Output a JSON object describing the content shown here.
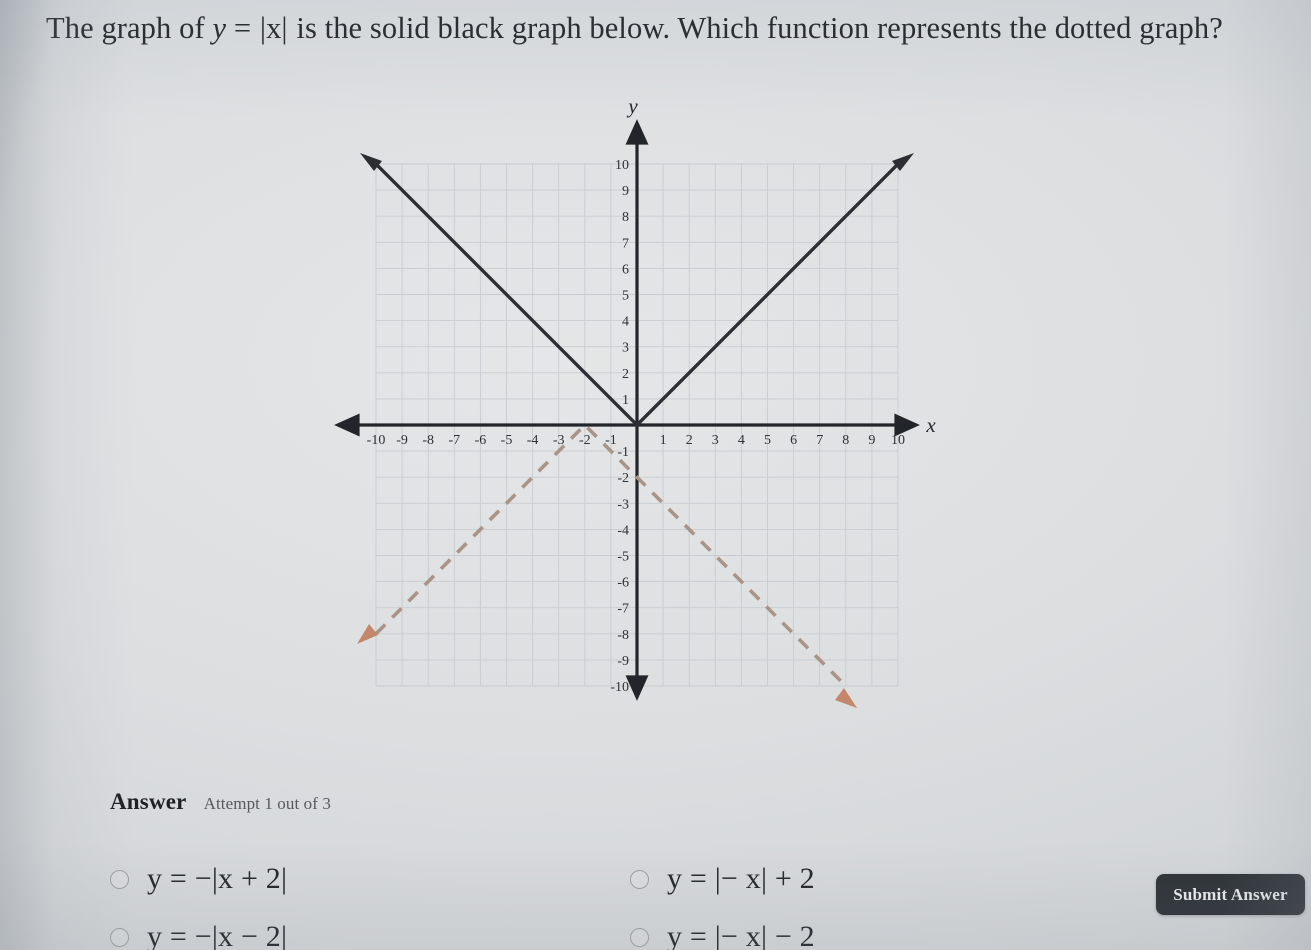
{
  "question": {
    "prefix": "The graph of ",
    "equation_y": "y",
    "equation_eq": "=",
    "equation_abs": "|x|",
    "suffix": " is the solid black graph below. Which function represents the dotted graph?"
  },
  "answer": {
    "title": "Answer",
    "attempt": "Attempt 1 out of 3",
    "options": [
      {
        "label": "y = −|x + 2|",
        "selected": false
      },
      {
        "label": "y = −|x − 2|",
        "selected": false
      },
      {
        "label": "y = |− x| + 2",
        "selected": false
      },
      {
        "label": "y = |− x| − 2",
        "selected": false
      }
    ]
  },
  "submit": {
    "label": "Submit Answer"
  },
  "colors": {
    "solid_curve": "#2b2f33",
    "dotted_curve": "#a99487",
    "dotted_arrow": "#c4876c",
    "axis": "#22262a",
    "grid": "#c3c7cb",
    "page_bg": "#dcdee0",
    "submit_bg": "#2e3338"
  },
  "chart_data": {
    "type": "line",
    "title": "",
    "xlabel": "x",
    "ylabel": "y",
    "xlim": [
      -10,
      10
    ],
    "ylim": [
      -10,
      10
    ],
    "grid": true,
    "legend": "none",
    "x_ticks": [
      -10,
      -9,
      -8,
      -7,
      -6,
      -5,
      -4,
      -3,
      -2,
      -1,
      1,
      2,
      3,
      4,
      5,
      6,
      7,
      8,
      9,
      10
    ],
    "y_ticks": [
      10,
      9,
      8,
      7,
      6,
      5,
      4,
      3,
      2,
      1,
      -1,
      -2,
      -3,
      -4,
      -5,
      -6,
      -7,
      -8,
      -9,
      -10
    ],
    "x_tick_labels": [
      "-10",
      "-9",
      "-8",
      "-7",
      "-6",
      "-5",
      "-4",
      "-3",
      "-2",
      "-1",
      "1",
      "2",
      "3",
      "4",
      "5",
      "6",
      "7",
      "8",
      "9",
      "10"
    ],
    "y_tick_labels": [
      "10",
      "9",
      "8",
      "7",
      "6",
      "5",
      "4",
      "3",
      "2",
      "1",
      "-1",
      "-2",
      "-3",
      "-4",
      "-5",
      "-6",
      "-7",
      "-8",
      "-9",
      "-10"
    ],
    "series": [
      {
        "name": "y = |x|",
        "style": "solid",
        "color": "#2b2f33",
        "arrows": "both",
        "points": [
          [
            -10,
            10
          ],
          [
            0,
            0
          ],
          [
            10,
            10
          ]
        ]
      },
      {
        "name": "dotted graph",
        "style": "dashed",
        "color": "#a99487",
        "arrows": "both",
        "vertex": [
          -2,
          0
        ],
        "points": [
          [
            -10,
            -8
          ],
          [
            -2,
            0
          ],
          [
            8,
            -10
          ]
        ]
      }
    ]
  }
}
